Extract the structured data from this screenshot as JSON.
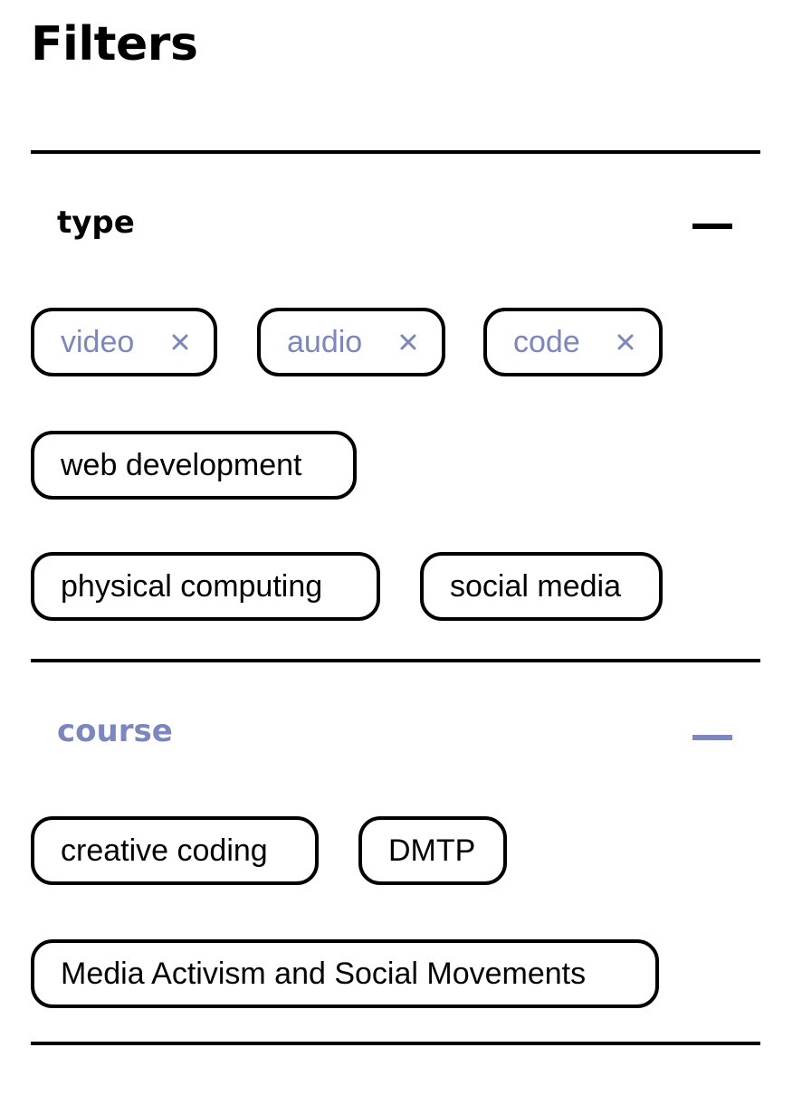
{
  "page": {
    "title": "Filters"
  },
  "colors": {
    "accent": "#7c86bf",
    "border": "#000000",
    "text": "#000000",
    "background": "#ffffff"
  },
  "sections": [
    {
      "title": "type",
      "expanded": true,
      "toggle_icon": "minus-icon",
      "tags": [
        {
          "label": "video",
          "selected": true,
          "remove_icon": "close-icon"
        },
        {
          "label": "audio",
          "selected": true,
          "remove_icon": "close-icon"
        },
        {
          "label": "code",
          "selected": true,
          "remove_icon": "close-icon"
        },
        {
          "label": "web development",
          "selected": false
        },
        {
          "label": "physical computing",
          "selected": false
        },
        {
          "label": "social media",
          "selected": false
        }
      ]
    },
    {
      "title": "course",
      "expanded": true,
      "highlighted": true,
      "toggle_icon": "minus-icon",
      "tags": [
        {
          "label": "creative coding",
          "selected": false
        },
        {
          "label": "DMTP",
          "selected": false
        },
        {
          "label": "Media Activism and Social Movements",
          "selected": false
        }
      ]
    }
  ]
}
